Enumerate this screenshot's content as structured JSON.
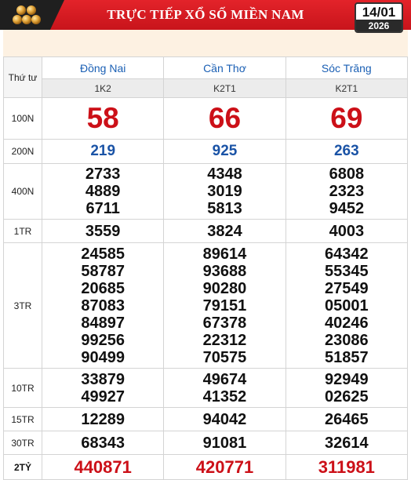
{
  "header": {
    "title": "TRỰC TIẾP XỔ SỐ MIỀN NAM",
    "date": "14/01",
    "year": "2026",
    "logo_icon": "lottery-balls-icon"
  },
  "table": {
    "day": "Thứ tư",
    "provinces": [
      {
        "name": "Đồng Nai",
        "code": "1K2"
      },
      {
        "name": "Cần Thơ",
        "code": "K2T1"
      },
      {
        "name": "Sóc Trăng",
        "code": "K2T1"
      }
    ],
    "prizes": [
      {
        "label": "100N",
        "results": [
          [
            "58"
          ],
          [
            "66"
          ],
          [
            "69"
          ]
        ]
      },
      {
        "label": "200N",
        "results": [
          [
            "219"
          ],
          [
            "925"
          ],
          [
            "263"
          ]
        ]
      },
      {
        "label": "400N",
        "results": [
          [
            "2733",
            "4889",
            "6711"
          ],
          [
            "4348",
            "3019",
            "5813"
          ],
          [
            "6808",
            "2323",
            "9452"
          ]
        ]
      },
      {
        "label": "1TR",
        "results": [
          [
            "3559"
          ],
          [
            "3824"
          ],
          [
            "4003"
          ]
        ]
      },
      {
        "label": "3TR",
        "results": [
          [
            "24585",
            "58787",
            "20685",
            "87083",
            "84897",
            "99256",
            "90499"
          ],
          [
            "89614",
            "93688",
            "90280",
            "79151",
            "67378",
            "22312",
            "70575"
          ],
          [
            "64342",
            "55345",
            "27549",
            "05001",
            "40246",
            "23086",
            "51857"
          ]
        ]
      },
      {
        "label": "10TR",
        "results": [
          [
            "33879",
            "49927"
          ],
          [
            "49674",
            "41352"
          ],
          [
            "92949",
            "02625"
          ]
        ]
      },
      {
        "label": "15TR",
        "results": [
          [
            "12289"
          ],
          [
            "94042"
          ],
          [
            "26465"
          ]
        ]
      },
      {
        "label": "30TR",
        "results": [
          [
            "68343"
          ],
          [
            "91081"
          ],
          [
            "32614"
          ]
        ]
      },
      {
        "label": "2TỶ",
        "results": [
          [
            "440871"
          ],
          [
            "420771"
          ],
          [
            "311981"
          ]
        ]
      }
    ]
  },
  "colors": {
    "header_red": "#d71c22",
    "prize_red": "#cc1018",
    "prize_blue": "#1a53a6",
    "province_blue": "#1a5fb4",
    "banner": "#fdf1e2"
  }
}
